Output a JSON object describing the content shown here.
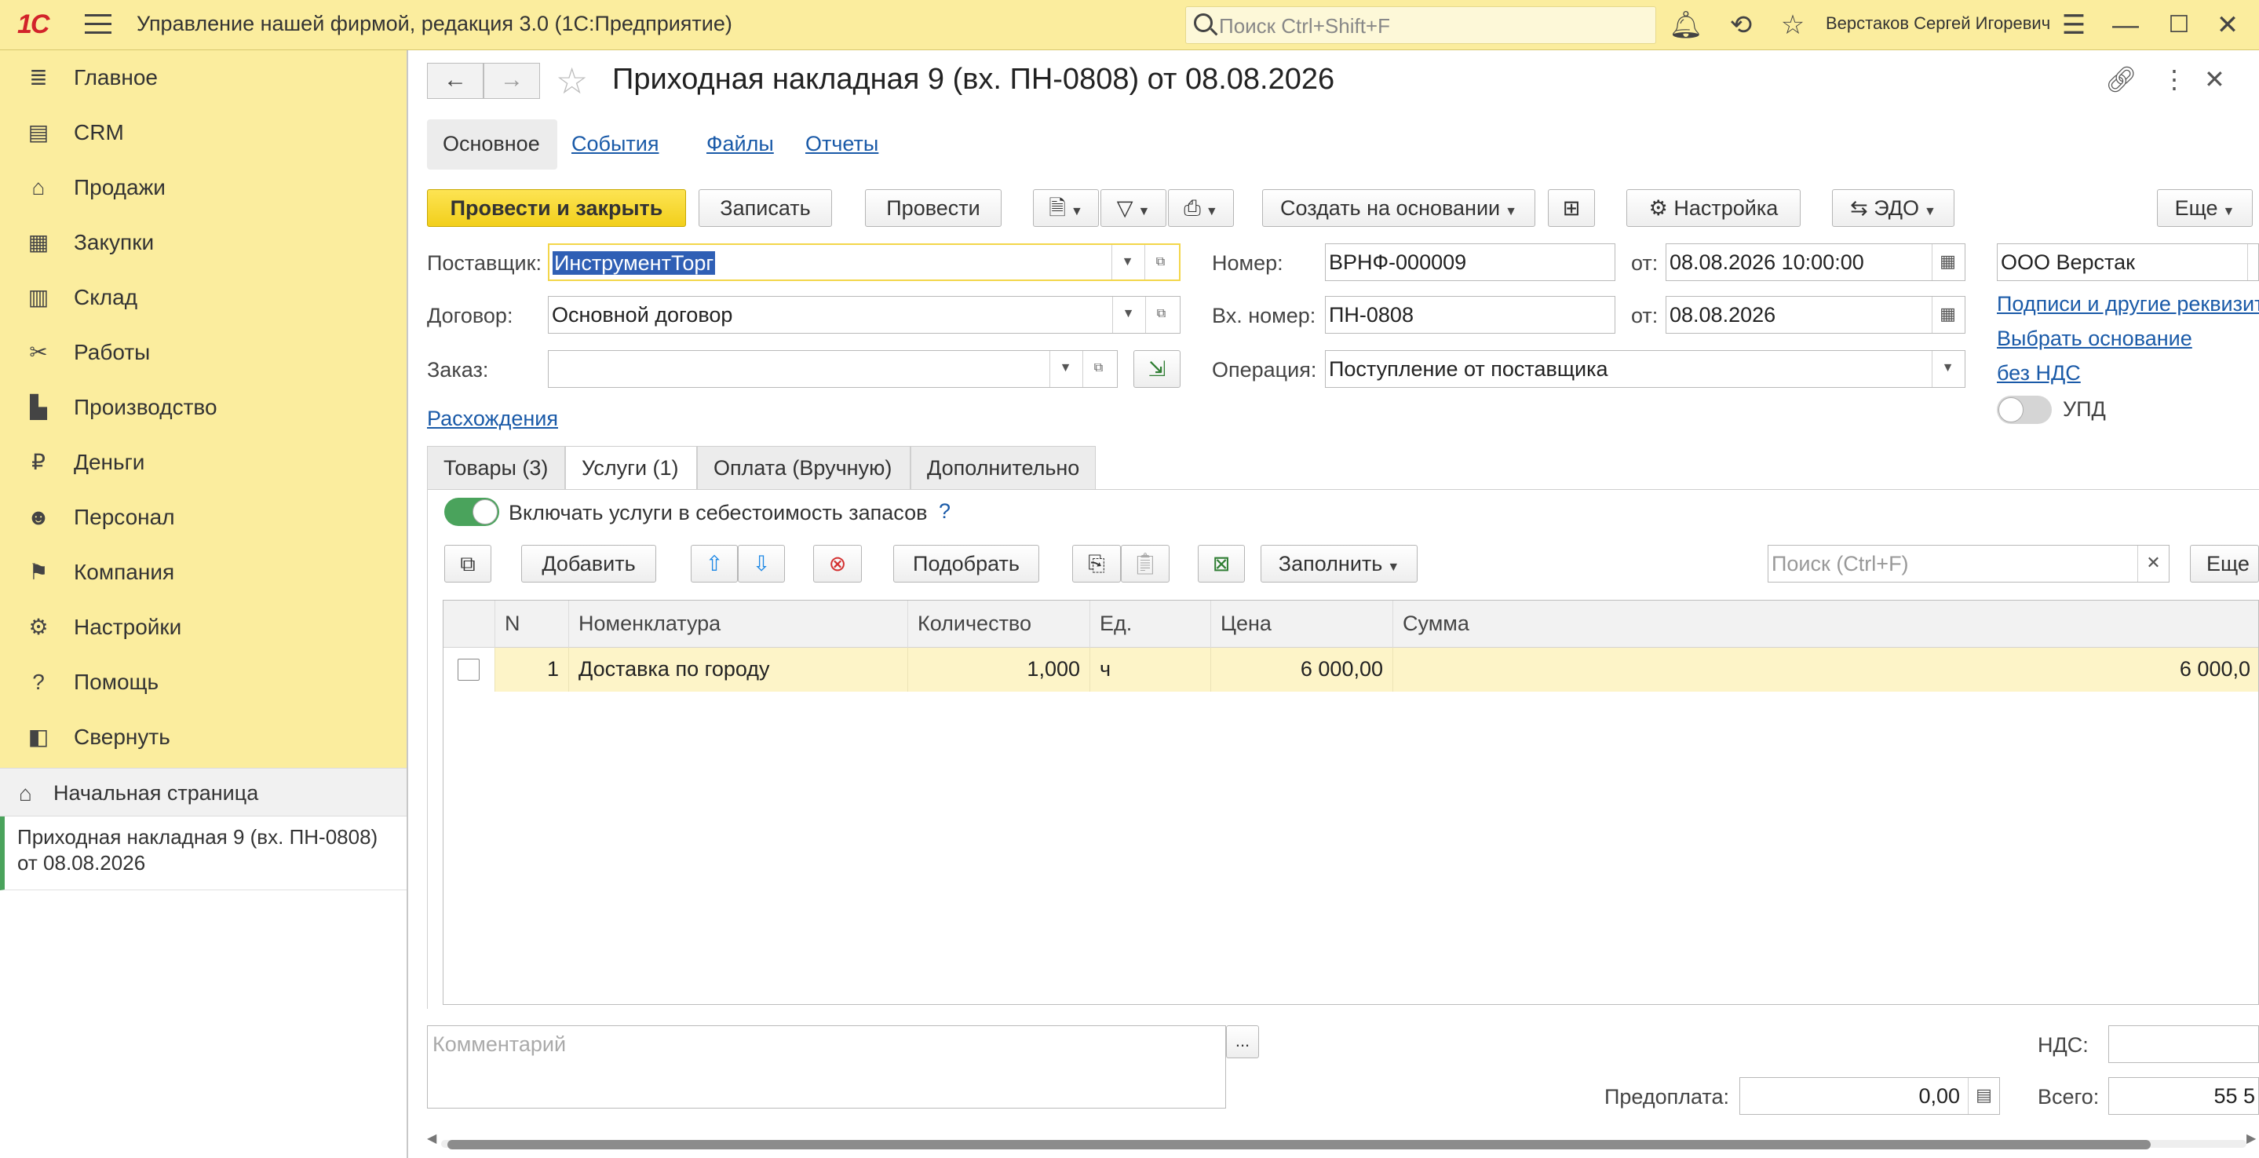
{
  "titlebar": {
    "logo": "1С",
    "app_title": "Управление нашей фирмой, редакция 3.0  (1С:Предприятие)",
    "search_placeholder": "Поиск Ctrl+Shift+F",
    "username": "Верстаков Сергей Игоревич"
  },
  "sidebar": {
    "items": [
      {
        "label": "Главное",
        "icon": "list-icon"
      },
      {
        "label": "CRM",
        "icon": "contacts-icon"
      },
      {
        "label": "Продажи",
        "icon": "basket-icon"
      },
      {
        "label": "Закупки",
        "icon": "cart-icon"
      },
      {
        "label": "Склад",
        "icon": "warehouse-icon"
      },
      {
        "label": "Работы",
        "icon": "tools-icon"
      },
      {
        "label": "Производство",
        "icon": "factory-icon"
      },
      {
        "label": "Деньги",
        "icon": "ruble-icon"
      },
      {
        "label": "Персонал",
        "icon": "people-icon"
      },
      {
        "label": "Компания",
        "icon": "flag-icon"
      },
      {
        "label": "Настройки",
        "icon": "gear-icon"
      },
      {
        "label": "Помощь",
        "icon": "help-icon"
      },
      {
        "label": "Свернуть",
        "icon": "collapse-icon"
      }
    ],
    "home_label": "Начальная страница",
    "open_window": "Приходная накладная 9 (вх. ПН-0808) от 08.08.2026"
  },
  "document": {
    "title": "Приходная накладная 9 (вх. ПН-0808) от 08.08.2026",
    "tabs": [
      "Основное",
      "События",
      "Файлы",
      "Отчеты"
    ]
  },
  "toolbar": {
    "post_close": "Провести и закрыть",
    "save": "Записать",
    "post": "Провести",
    "create_based": "Создать на основании",
    "settings": "Настройка",
    "edo": "ЭДО",
    "more": "Еще"
  },
  "form": {
    "supplier_label": "Поставщик:",
    "supplier_value": "ИнструментТорг",
    "contract_label": "Договор:",
    "contract_value": "Основной договор",
    "order_label": "Заказ:",
    "order_value": "",
    "number_label": "Номер:",
    "number_value": "ВРНФ-000009",
    "date_label": "от:",
    "date_value": "08.08.2026 10:00:00",
    "in_number_label": "Вх. номер:",
    "in_number_value": "ПН-0808",
    "in_date_label": "от:",
    "in_date_value": "08.08.2026",
    "operation_label": "Операция:",
    "operation_value": "Поступление от поставщика",
    "company_value": "ООО Верстак",
    "link_signatures": "Подписи и другие реквизиты",
    "link_basis": "Выбрать основание",
    "link_vat": "без НДС",
    "upd_label": "УПД",
    "discrepancies_link": "Расхождения"
  },
  "detail_tabs": [
    "Товары (3)",
    "Услуги (1)",
    "Оплата (Вручную)",
    "Дополнительно"
  ],
  "services": {
    "include_cost_label": "Включать услуги в себестоимость запасов",
    "help_mark": "?",
    "add_button": "Добавить",
    "pick_button": "Подобрать",
    "fill_button": "Заполнить",
    "search_placeholder": "Поиск (Ctrl+F)",
    "more_button": "Еще",
    "columns": [
      "N",
      "Номенклатура",
      "Количество",
      "Ед.",
      "Цена",
      "Сумма"
    ],
    "rows": [
      {
        "n": "1",
        "item": "Доставка по городу",
        "qty": "1,000",
        "unit": "ч",
        "price": "6 000,00",
        "sum": "6 000,0"
      }
    ]
  },
  "footer": {
    "comment_placeholder": "Комментарий",
    "comment_btn": "...",
    "vat_label": "НДС:",
    "vat_value": "",
    "prepay_label": "Предоплата:",
    "prepay_value": "0,00",
    "total_label": "Всего:",
    "total_value": "55 5"
  },
  "colors": {
    "accent_yellow": "#fbed9e",
    "primary_button": "#f5d320",
    "link": "#1a5aa8",
    "toggle_on": "#4aa35c",
    "row_highlight": "#fdf4c8"
  }
}
